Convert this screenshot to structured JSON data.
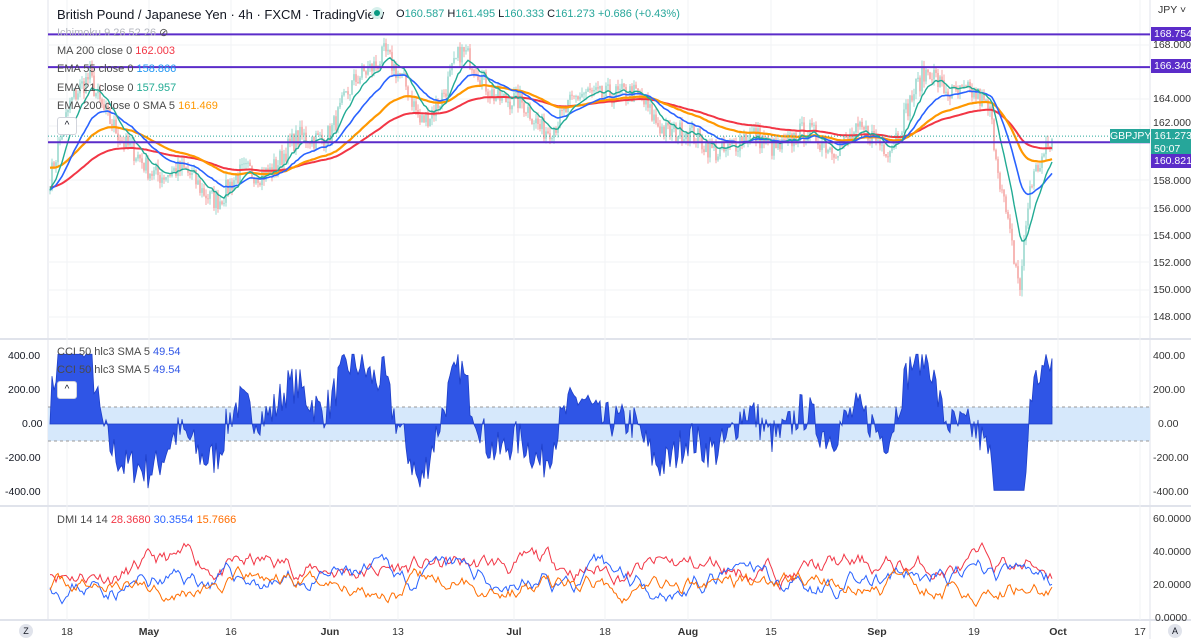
{
  "header": {
    "title": "British Pound / Japanese Yen · 4h · FXCM · TradingView",
    "open": "160.587",
    "high": "161.495",
    "low": "160.333",
    "close": "161.273",
    "change": "+0.686 (+0.43%)",
    "o": "O",
    "h": "H",
    "l": "L",
    "c": "C"
  },
  "legend": {
    "ichimoku": "Ichimoku 9 26 52 26",
    "ma200_label": "MA 200 close 0",
    "ma200": "162.003",
    "ema55_label": "EMA 55 close 0",
    "ema55": "158.866",
    "ema21_label": "EMA 21 close 0",
    "ema21": "157.957",
    "ema200_label": "EMA 200 close 0 SMA 5",
    "ema200": "161.469"
  },
  "cci": {
    "label1": "CCI 50 hlc3 SMA 5",
    "value1": "49.54",
    "label2": "CCI 50 hlc3 SMA 5",
    "value2": "49.54",
    "axis": [
      "400.00",
      "200.00",
      "0.00",
      "-200.00",
      "-400.00"
    ]
  },
  "dmi": {
    "label": "DMI 14 14",
    "plus": "28.3680",
    "minus": "30.3554",
    "adx": "15.7666",
    "axis": [
      "60.0000",
      "40.0000",
      "20.0000",
      "0.0000"
    ]
  },
  "price_axis": {
    "currency": "JPY",
    "ticks": [
      "168.000",
      "164.000",
      "162.000",
      "158.000",
      "156.000",
      "154.000",
      "152.000",
      "150.000",
      "148.000"
    ],
    "lines": [
      {
        "value": "168.754"
      },
      {
        "value": "166.340"
      },
      {
        "value": "160.821"
      }
    ],
    "symbol": "GBPJPY",
    "last": "161.273",
    "countdown": "50:07"
  },
  "x_axis": [
    "18",
    "May",
    "16",
    "Jun",
    "13",
    "Jul",
    "18",
    "Aug",
    "15",
    "Sep",
    "19",
    "Oct",
    "17"
  ],
  "buttons": {
    "z": "Z",
    "a": "A",
    "collapse": "^"
  },
  "colors": {
    "up": "#26a69a",
    "down": "#ef5350",
    "ma200": "#f23645",
    "ema55": "#2962ff",
    "ema21": "#22ab94",
    "ema200": "#ff9800",
    "hline": "#5b2cc9",
    "cci": "#2f55e6"
  },
  "chart_data": {
    "type": "line",
    "title": "GBPJPY 4h",
    "price_keypoints": [
      [
        "Apr 14",
        158.5
      ],
      [
        "Apr 18",
        163
      ],
      [
        "Apr 22",
        166
      ],
      [
        "Apr 28",
        160
      ],
      [
        "May 16",
        157
      ],
      [
        "Jun 1",
        162
      ],
      [
        "Jun 9",
        168
      ],
      [
        "Jun 16",
        162
      ],
      [
        "Jun 23",
        167
      ],
      [
        "Jul 5",
        162
      ],
      [
        "Jul 20",
        165
      ],
      [
        "Aug 1",
        160.5
      ],
      [
        "Aug 15",
        161
      ],
      [
        "Sep 1",
        161
      ],
      [
        "Sep 8",
        166
      ],
      [
        "Sep 20",
        163
      ],
      [
        "Sep 26",
        150
      ],
      [
        "Sep 28",
        157
      ],
      [
        "Sep 30",
        161.27
      ]
    ],
    "ylim": [
      147,
      169
    ]
  }
}
